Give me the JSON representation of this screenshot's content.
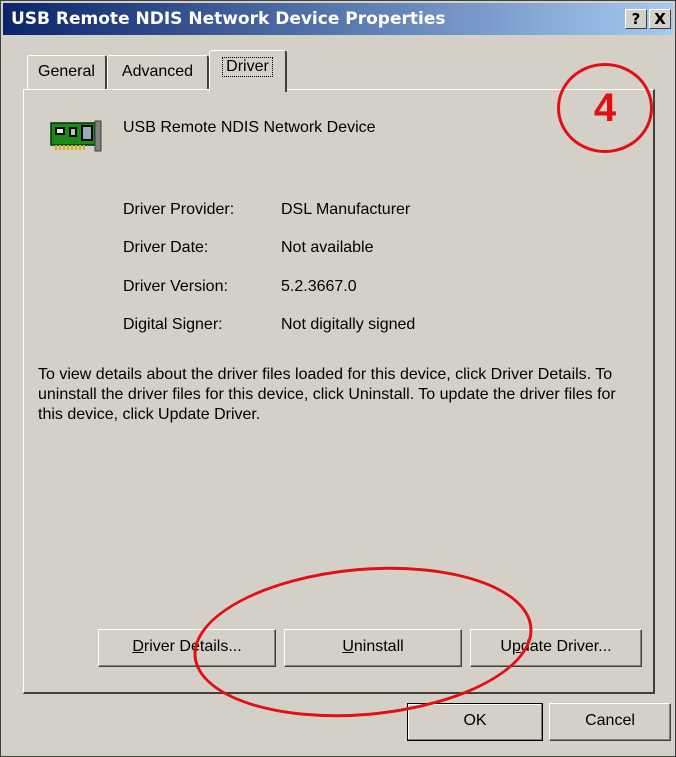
{
  "window": {
    "title": "USB Remote NDIS Network Device Properties",
    "help_label": "?",
    "close_label": "X"
  },
  "tabs": [
    {
      "label": "General"
    },
    {
      "label": "Advanced"
    },
    {
      "label": "Driver",
      "selected": true
    }
  ],
  "device": {
    "name": "USB Remote NDIS Network Device",
    "icon": "network-adapter-icon"
  },
  "info": [
    {
      "label": "Driver Provider:",
      "value": "DSL Manufacturer"
    },
    {
      "label": "Driver Date:",
      "value": "Not available"
    },
    {
      "label": "Driver Version:",
      "value": "5.2.3667.0"
    },
    {
      "label": "Digital Signer:",
      "value": "Not digitally signed"
    }
  ],
  "description": "To view details about the driver files loaded for this device, click Driver Details. To uninstall the driver files for this device, click Uninstall. To update the driver files for this device, click Update Driver.",
  "buttons": {
    "driver_details": {
      "pre": "",
      "u": "D",
      "post": "river Details..."
    },
    "uninstall": {
      "pre": "",
      "u": "U",
      "post": "ninstall"
    },
    "update_driver": {
      "pre": "U",
      "u": "p",
      "post": "date Driver..."
    },
    "ok": "OK",
    "cancel": "Cancel"
  },
  "annotation": {
    "step_number": "4",
    "color": "#e21010"
  }
}
